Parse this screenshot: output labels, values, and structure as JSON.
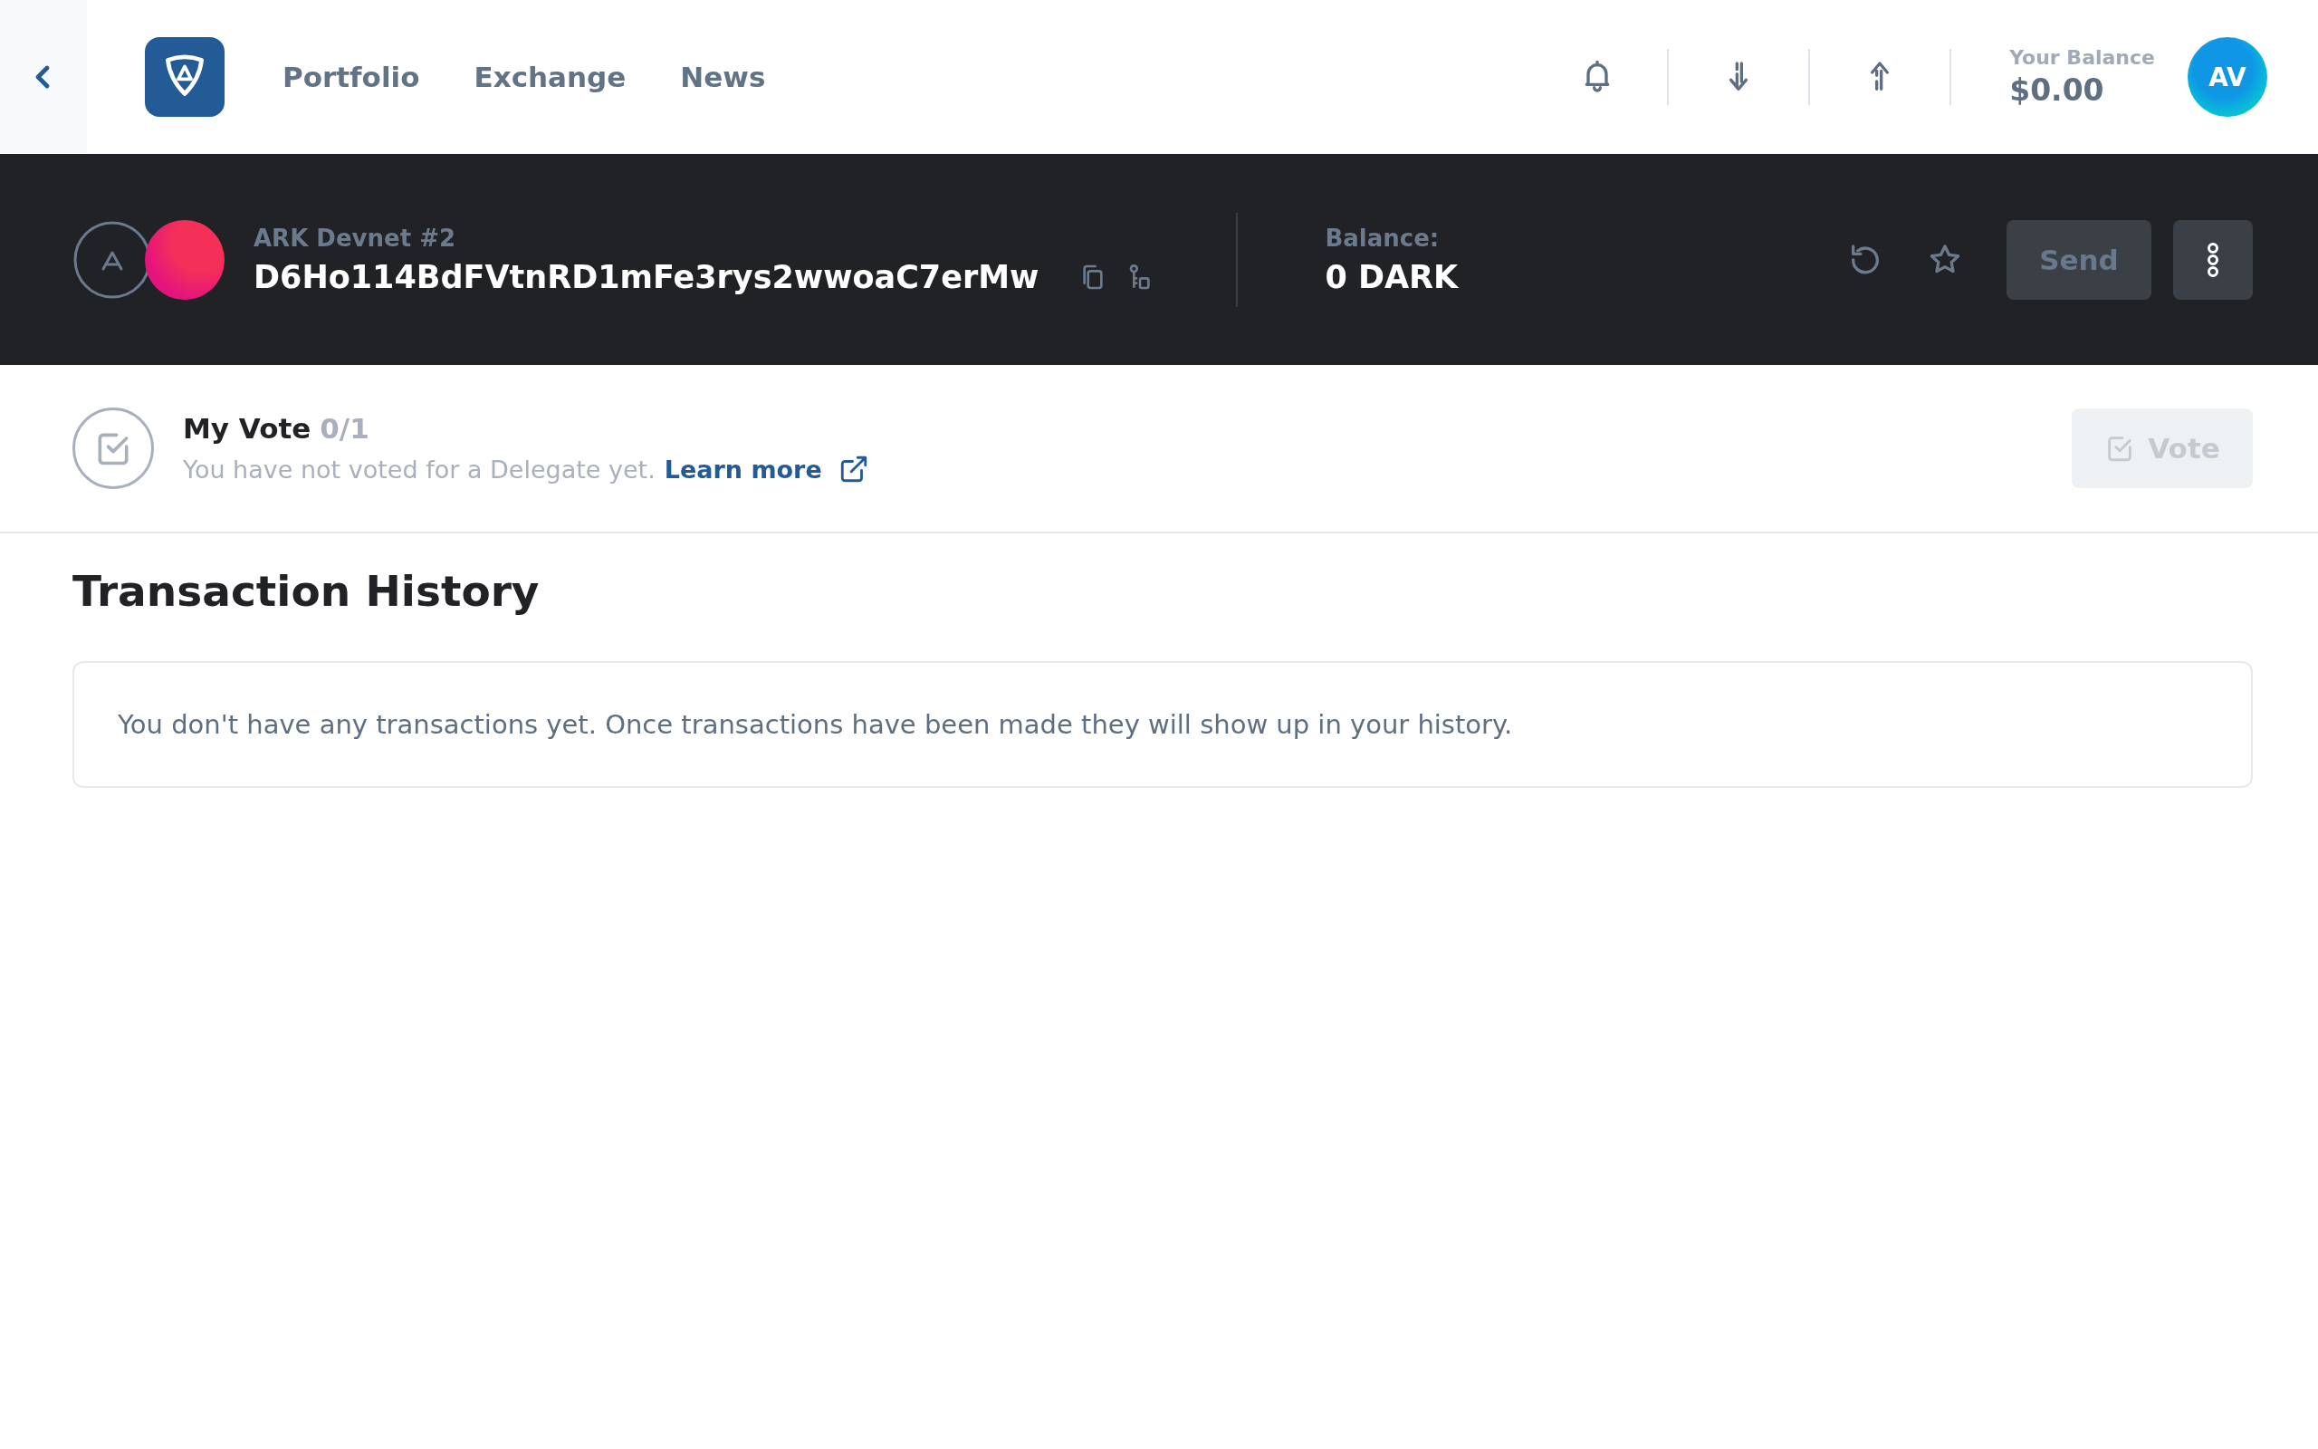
{
  "nav": {
    "links": [
      {
        "label": "Portfolio"
      },
      {
        "label": "Exchange"
      },
      {
        "label": "News"
      }
    ],
    "balance_label": "Your Balance",
    "balance": "$0.00",
    "avatar": "AV"
  },
  "wallet": {
    "name": "ARK Devnet #2",
    "address": "D6Ho114BdFVtnRD1mFe3rys2wwoaC7erMw",
    "balance_label": "Balance:",
    "balance": "0 DARK",
    "send": {
      "label": "Send",
      "disabled": true
    }
  },
  "vote": {
    "title": "My Vote",
    "count": "0/1",
    "message": "You have not voted for a Delegate yet.",
    "link": "Learn more",
    "button": {
      "label": "Vote",
      "disabled": true
    }
  },
  "history": {
    "title": "Transaction History",
    "empty_message": "You don't have any transactions yet. Once transactions have been made they will show up in your history."
  }
}
